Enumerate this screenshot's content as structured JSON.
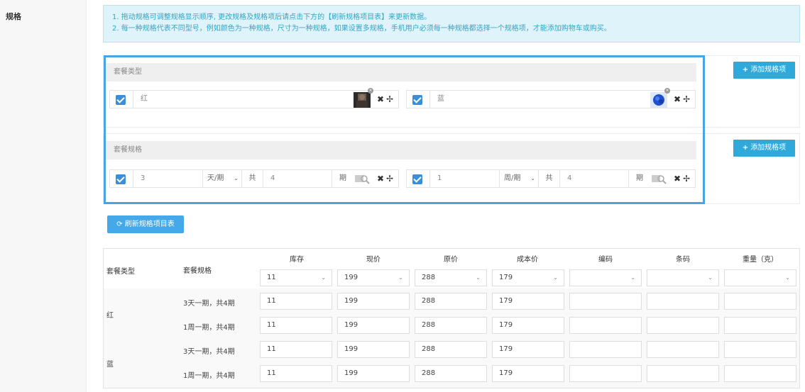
{
  "section_label": "规格",
  "notice": {
    "line1": "1. 拖动规格可调整规格显示顺序, 更改规格及规格项后请点击下方的【刷新规格项目表】来更新数据。",
    "line2": "2. 每一种规格代表不同型号，例如颜色为一种规格，尺寸为一种规格，如果设置多规格，手机用户必须每一种规格都选择一个规格项，才能添加购物车或购买。"
  },
  "spec_groups": [
    {
      "title": "套餐类型",
      "add_label": "添加规格项",
      "items": [
        {
          "value": "红"
        },
        {
          "value": "蓝"
        }
      ]
    },
    {
      "title": "套餐规格",
      "add_label": "添加规格项",
      "items": [
        {
          "value": "3",
          "unit": "天/期",
          "gong": "共",
          "count": "4",
          "qi": "期"
        },
        {
          "value": "1",
          "unit": "周/期",
          "gong": "共",
          "count": "4",
          "qi": "期"
        }
      ]
    }
  ],
  "refresh_label": "刷新规格项目表",
  "table": {
    "col_type": "套餐类型",
    "col_spec": "套餐规格",
    "columns": [
      "库存",
      "现价",
      "原价",
      "成本价",
      "编码",
      "条码",
      "重量（克）"
    ],
    "batch_values": [
      "11",
      "199",
      "288",
      "179",
      "",
      "",
      ""
    ],
    "groups": [
      {
        "type": "红",
        "rows": [
          {
            "spec": "3天一期，共4期",
            "values": [
              "11",
              "199",
              "288",
              "179",
              "",
              "",
              ""
            ]
          },
          {
            "spec": "1周一期，共4期",
            "values": [
              "11",
              "199",
              "288",
              "179",
              "",
              "",
              ""
            ]
          }
        ]
      },
      {
        "type": "蓝",
        "rows": [
          {
            "spec": "3天一期，共4期",
            "values": [
              "11",
              "199",
              "288",
              "179",
              "",
              "",
              ""
            ]
          },
          {
            "spec": "1周一期，共4期",
            "values": [
              "11",
              "199",
              "288",
              "179",
              "",
              "",
              ""
            ]
          }
        ]
      }
    ]
  },
  "icons": {
    "check": "checkbox-checked-icon",
    "remove": "close-icon",
    "move": "move-arrows-icon",
    "refresh": "refresh-icon",
    "plus": "plus-icon",
    "chevron": "chevron-down-icon"
  },
  "colors": {
    "accent": "#2fa8da",
    "checkbox": "#3a8fd8",
    "notice_bg": "#def4fa",
    "notice_text": "#31a5c8",
    "highlight": "#4aa3e3"
  }
}
